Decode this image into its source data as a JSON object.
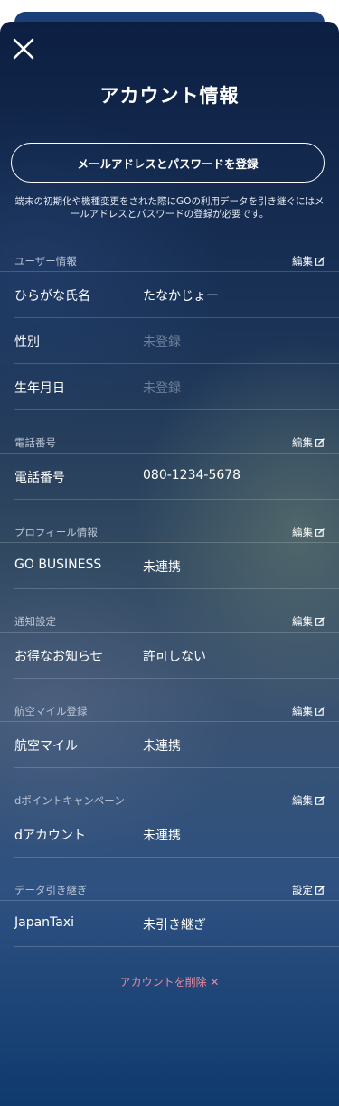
{
  "header": {
    "title": "アカウント情報"
  },
  "register_button": "メールアドレスとパスワードを登録",
  "note": "端末の初期化や機種変更をされた際にGOの利用データを引き継ぐにはメールアドレスとパスワードの登録が必要です。",
  "sections": {
    "user": {
      "label": "ユーザー情報",
      "action": "編集",
      "rows": [
        {
          "key": "ひらがな氏名",
          "value": "たなかじょー"
        },
        {
          "key": "性別",
          "value": "未登録"
        },
        {
          "key": "生年月日",
          "value": "未登録"
        }
      ]
    },
    "phone": {
      "label": "電話番号",
      "action": "編集",
      "rows": [
        {
          "key": "電話番号",
          "value": "080-1234-5678"
        }
      ]
    },
    "profile": {
      "label": "プロフィール情報",
      "action": "編集",
      "rows": [
        {
          "key": "GO BUSINESS",
          "value": "未連携"
        }
      ]
    },
    "notify": {
      "label": "通知設定",
      "action": "編集",
      "rows": [
        {
          "key": "お得なお知らせ",
          "value": "許可しない"
        }
      ]
    },
    "mileage": {
      "label": "航空マイル登録",
      "action": "編集",
      "rows": [
        {
          "key": "航空マイル",
          "value": "未連携"
        }
      ]
    },
    "dpoint": {
      "label": "dポイントキャンペーン",
      "action": "編集",
      "rows": [
        {
          "key": "dアカウント",
          "value": "未連携"
        }
      ]
    },
    "transfer": {
      "label": "データ引き継ぎ",
      "action": "設定",
      "rows": [
        {
          "key": "JapanTaxi",
          "value": "未引き継ぎ"
        }
      ]
    }
  },
  "delete_link": "アカウントを削除 ✕",
  "colors": {
    "accent_delete": "#e98aa0",
    "muted_value": "#6f7f98"
  },
  "icons": {
    "close": "close-icon",
    "edit": "edit-icon"
  }
}
